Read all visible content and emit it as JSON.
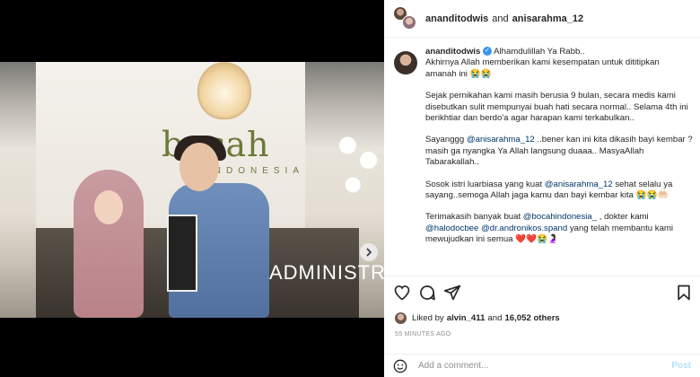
{
  "header": {
    "user1": "ananditodwis",
    "and": "and",
    "user2": "anisarahma_12"
  },
  "caption": {
    "username": "ananditodwis",
    "first_line": "Alhamdulillah Ya Rabb..",
    "p1": "Akhirnya Allah memberikan kami kesempatan untuk dititipkan amanah ini 😭😭",
    "p2": "Sejak pernikahan kami masih berusia 9 bulan, secara medis kami disebutkan sulit mempunyai buah hati secara normal.. Selama 4th ini berikhtiar dan berdo'a agar harapan kami terkabulkan..",
    "p3_a": "Sayanggg ",
    "p3_mention": "@anisarahma_12",
    "p3_b": " ..bener kan ini kita dikasih bayi kembar ? masih ga nyangka Ya Allah langsung duaaa.. MasyaAllah Tabarakallah..",
    "p4_a": "Sosok istri luarbiasa yang kuat ",
    "p4_mention": "@anisarahma_12",
    "p4_b": " sehat selalu ya sayang..semoga Allah jaga kamu dan bayi kembar kita 😭😭🤲🏻",
    "p5_a": "Terimakasih banyak buat ",
    "p5_mention1": "@bocahindonesia_",
    "p5_b": " , dokter kami ",
    "p5_mention2": "@halodocbee",
    "p5_c": " ",
    "p5_mention3": "@dr.andronikos.spand",
    "p5_d": " yang telah membantu kami mewujudkan ini semua ❤️❤️😭🤰🏻"
  },
  "photo": {
    "logo_text": "bocah",
    "logo_sub": "INDONESIA",
    "counter_sign": "ADMINISTRA"
  },
  "likes": {
    "prefix": "Liked by",
    "user": "alvin_411",
    "middle": "and",
    "count": "16,052 others"
  },
  "timestamp": "55 MINUTES AGO",
  "comment": {
    "placeholder": "Add a comment...",
    "post_label": "Post"
  },
  "icons": [
    "heart-icon",
    "comment-icon",
    "share-icon",
    "bookmark-icon",
    "emoji-icon",
    "mute-icon",
    "tag-user-icon",
    "chevron-right-icon",
    "verified-icon"
  ],
  "colors": {
    "link": "#00376b",
    "verified": "#3897f0",
    "post": "#b2dffc",
    "carousel_active": "#1f8cf0"
  }
}
